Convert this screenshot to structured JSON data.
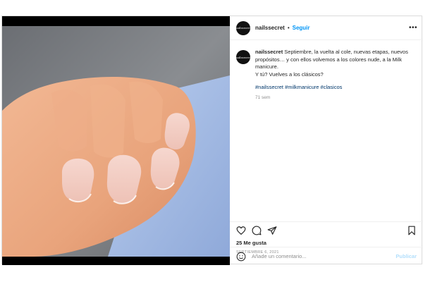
{
  "post": {
    "username": "nailssecret",
    "separator": "•",
    "follow_label": "Seguir",
    "more_label": "•••",
    "avatar_text": "nailssecret",
    "caption_text": "Septiembre, la vuelta al cole, nuevas etapas, nuevos propósitos… y con ellos volvemos a los colores nude, a la Milk manicure.",
    "caption_line2": "Y tú? Vuelves a los clásicos?",
    "hashtags": "#nailssecret #milkmanicure #clasicos",
    "time_ago": "71 sem",
    "likes": "25 Me gusta",
    "date": "SEPTIEMBRE 6, 2021"
  },
  "comment_box": {
    "placeholder": "Añade un comentario...",
    "publish_label": "Publicar"
  },
  "icons": {
    "like": "heart-icon",
    "comment": "comment-icon",
    "share": "share-icon",
    "save": "bookmark-icon",
    "emoji": "emoji-icon"
  },
  "colors": {
    "link": "#0095f6",
    "hashtag": "#00376b",
    "muted": "#8e8e8e",
    "publish_disabled": "#b2dffc"
  }
}
